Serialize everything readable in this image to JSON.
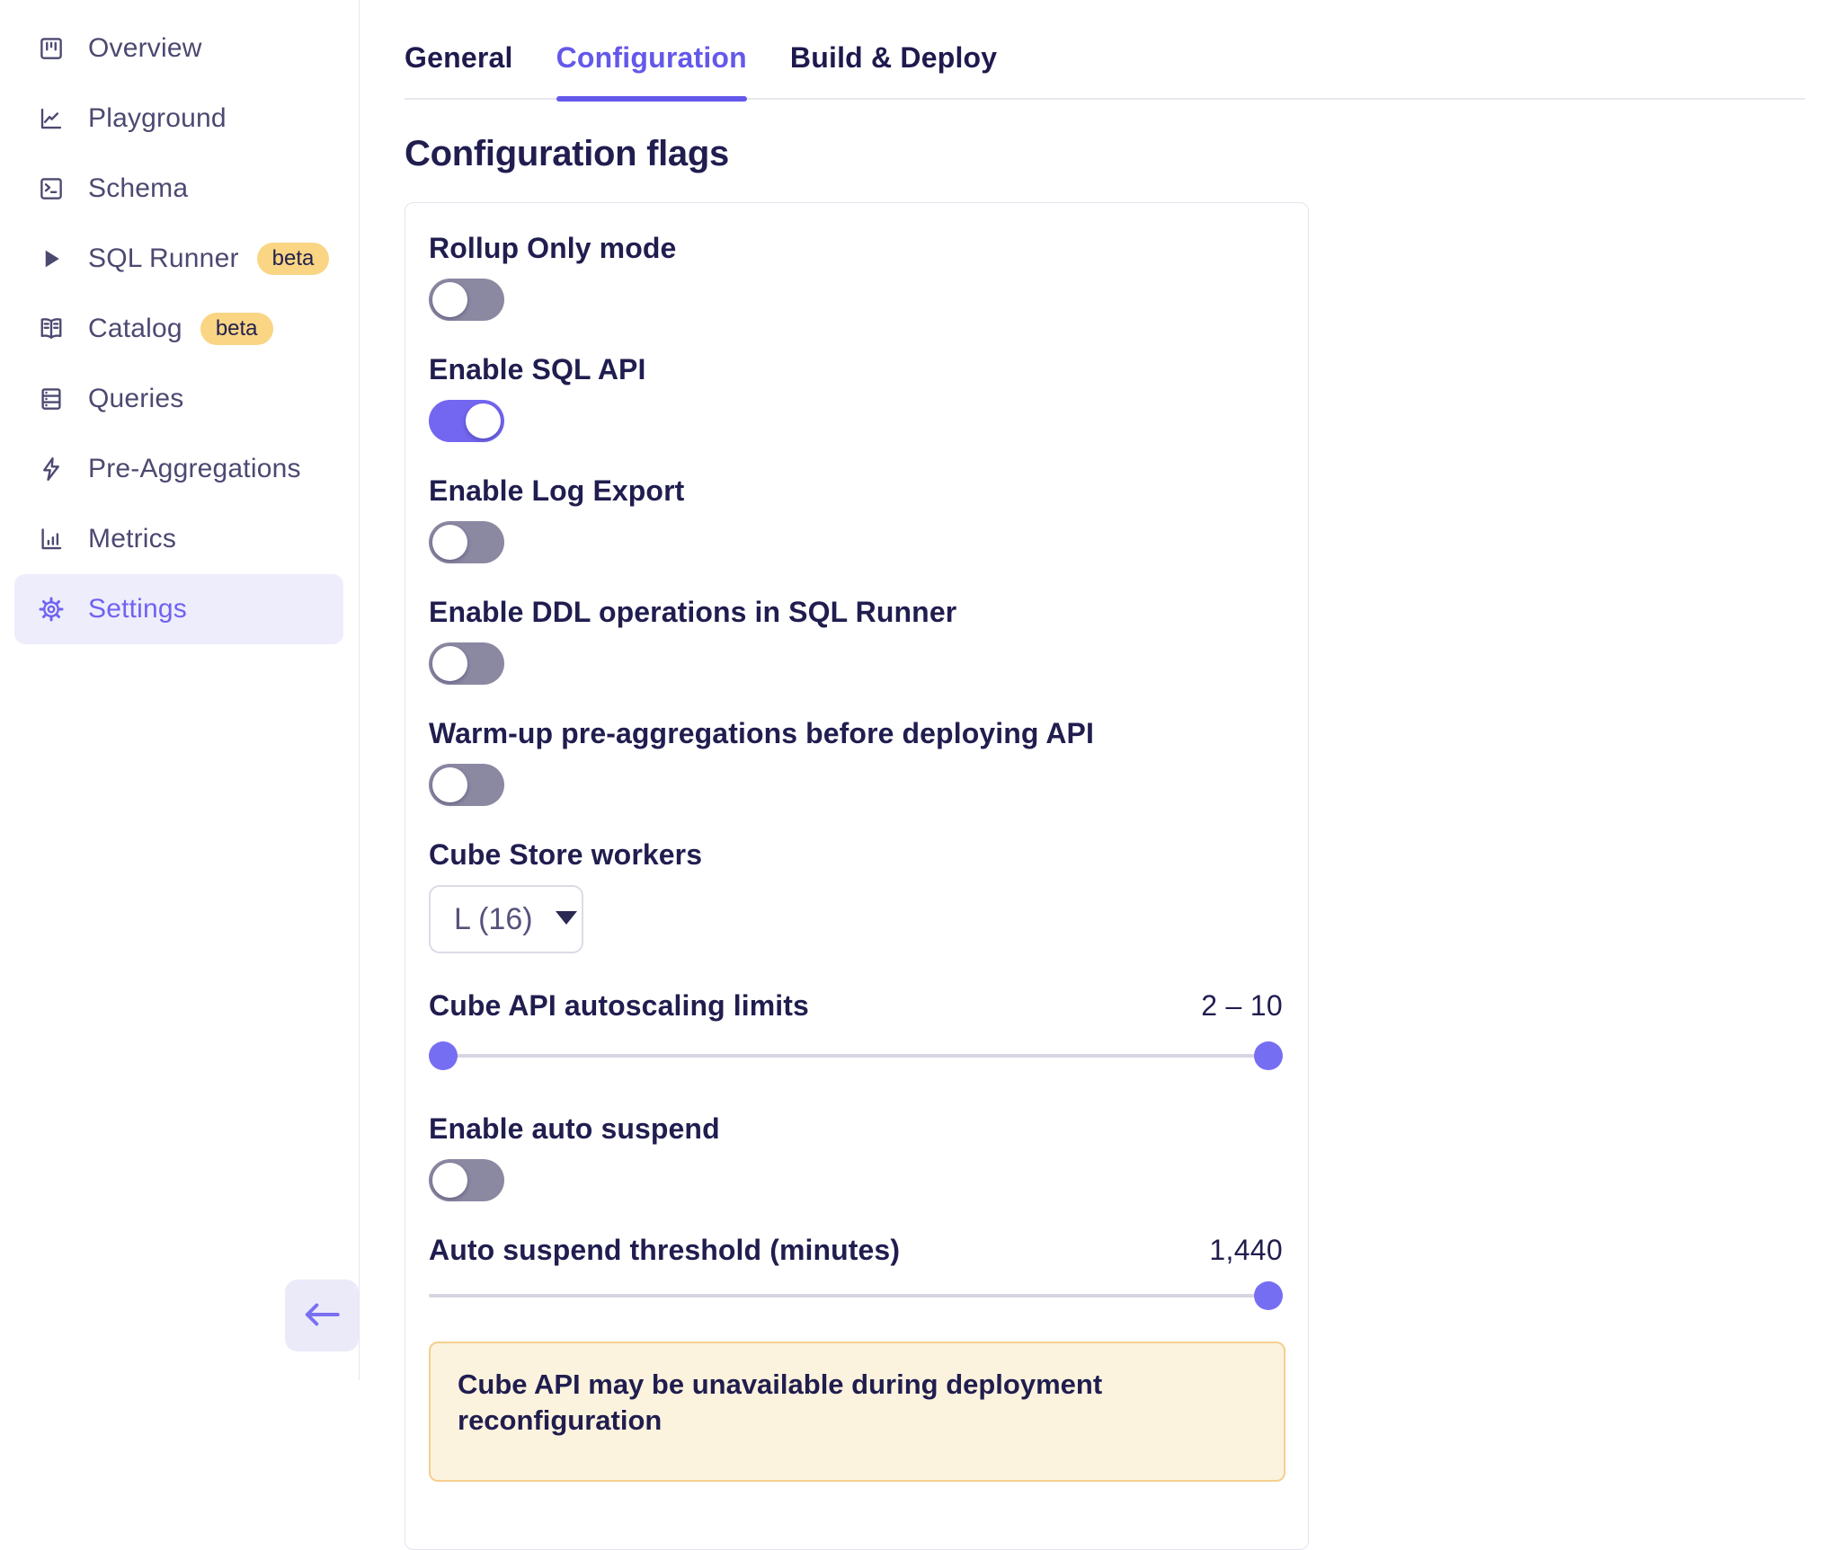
{
  "sidebar": {
    "items": [
      {
        "label": "Overview",
        "icon": "board-icon",
        "badge": null,
        "active": false
      },
      {
        "label": "Playground",
        "icon": "chart-line-icon",
        "badge": null,
        "active": false
      },
      {
        "label": "Schema",
        "icon": "terminal-icon",
        "badge": null,
        "active": false
      },
      {
        "label": "SQL Runner",
        "icon": "play-icon",
        "badge": "beta",
        "active": false
      },
      {
        "label": "Catalog",
        "icon": "book-open-icon",
        "badge": "beta",
        "active": false
      },
      {
        "label": "Queries",
        "icon": "server-icon",
        "badge": null,
        "active": false
      },
      {
        "label": "Pre-Aggregations",
        "icon": "lightning-icon",
        "badge": null,
        "active": false
      },
      {
        "label": "Metrics",
        "icon": "bar-chart-icon",
        "badge": null,
        "active": false
      },
      {
        "label": "Settings",
        "icon": "gear-icon",
        "badge": null,
        "active": true
      }
    ],
    "collapse_icon": "arrow-left-icon"
  },
  "tabs": [
    {
      "label": "General",
      "active": false
    },
    {
      "label": "Configuration",
      "active": true
    },
    {
      "label": "Build & Deploy",
      "active": false
    }
  ],
  "page": {
    "heading": "Configuration flags"
  },
  "flags": {
    "rollup_only": {
      "label": "Rollup Only mode",
      "enabled": false
    },
    "sql_api": {
      "label": "Enable SQL API",
      "enabled": true
    },
    "log_export": {
      "label": "Enable Log Export",
      "enabled": false
    },
    "ddl": {
      "label": "Enable DDL operations in SQL Runner",
      "enabled": false
    },
    "warmup": {
      "label": "Warm-up pre-aggregations before deploying API",
      "enabled": false
    },
    "auto_suspend": {
      "label": "Enable auto suspend",
      "enabled": false
    }
  },
  "cube_store_workers": {
    "label": "Cube Store workers",
    "value": "L (16)"
  },
  "autoscaling": {
    "label": "Cube API autoscaling limits",
    "value": "2 – 10",
    "handle_percents": [
      0,
      100
    ]
  },
  "suspend_threshold": {
    "label": "Auto suspend threshold (minutes)",
    "value": "1,440",
    "handle_percents": [
      100
    ]
  },
  "warning": {
    "text": "Cube API may be unavailable during deployment reconfiguration"
  },
  "colors": {
    "accent": "#6458EA",
    "toggle_on": "#7366F0",
    "toggle_off": "#8B88A2",
    "badge_bg": "#F9D584",
    "warning_bg": "#FCF3DE",
    "warning_border": "#F5CE8F",
    "text_dark": "#201D4F"
  }
}
